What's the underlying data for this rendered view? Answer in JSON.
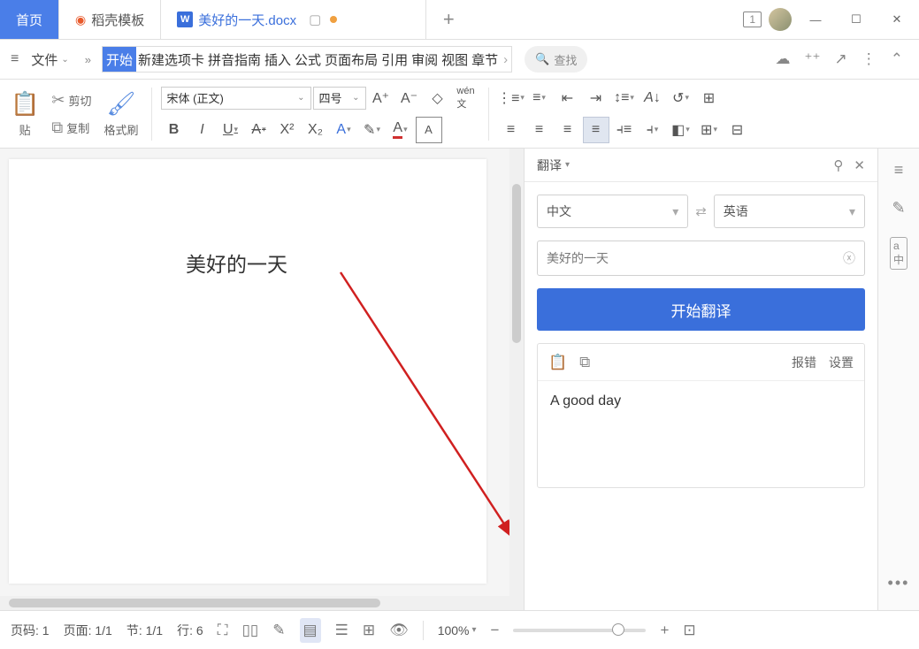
{
  "tabs": {
    "home": "首页",
    "templates": "稻壳模板",
    "doc": "美好的一天.docx"
  },
  "window_badge": "1",
  "menubar": {
    "file": "文件",
    "items": [
      "开始",
      "新建选项卡",
      "拼音指南",
      "插入",
      "公式",
      "页面布局",
      "引用",
      "审阅",
      "视图",
      "章节"
    ],
    "search": "查找"
  },
  "ribbon": {
    "paste": "贴",
    "cut": "剪切",
    "copy": "复制",
    "format_painter": "格式刷",
    "font_name": "宋体 (正文)",
    "font_size": "四号"
  },
  "document": {
    "content": "美好的一天"
  },
  "panel": {
    "title": "翻译",
    "source_lang": "中文",
    "target_lang": "英语",
    "input_text": "美好的一天",
    "translate_btn": "开始翻译",
    "report": "报错",
    "settings": "设置",
    "result": "A good day"
  },
  "statusbar": {
    "page_code": "页码: 1",
    "page": "页面: 1/1",
    "section": "节: 1/1",
    "line": "行: 6",
    "zoom": "100%"
  }
}
